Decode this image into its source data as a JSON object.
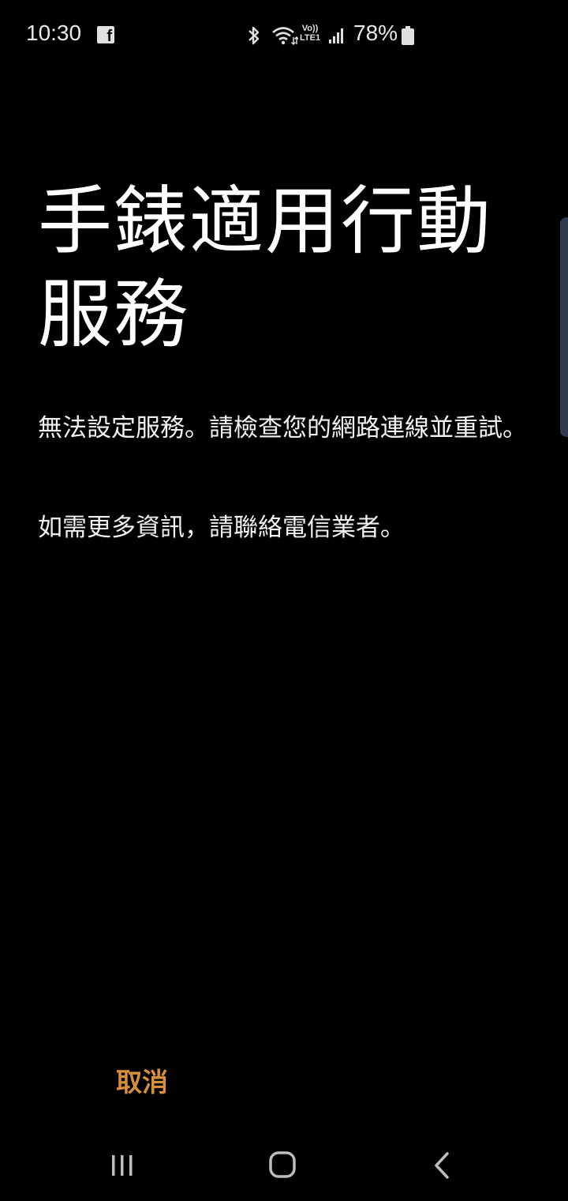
{
  "status_bar": {
    "time": "10:30",
    "notification_icon": "facebook-icon",
    "network_badge_top": "Vo))",
    "network_badge_bottom": "LTE1",
    "battery_percent": "78%"
  },
  "title": "手錶適用行動服務",
  "messages": {
    "error": "無法設定服務。請檢查您的網路連線並重試。",
    "info": "如需更多資訊，請聯絡電信業者。"
  },
  "actions": {
    "cancel_label": "取消"
  },
  "navigation": {
    "recents": "recents-icon",
    "home": "home-icon",
    "back": "back-icon"
  },
  "colors": {
    "background": "#000000",
    "text": "#ffffff",
    "accent": "#d6903a"
  }
}
